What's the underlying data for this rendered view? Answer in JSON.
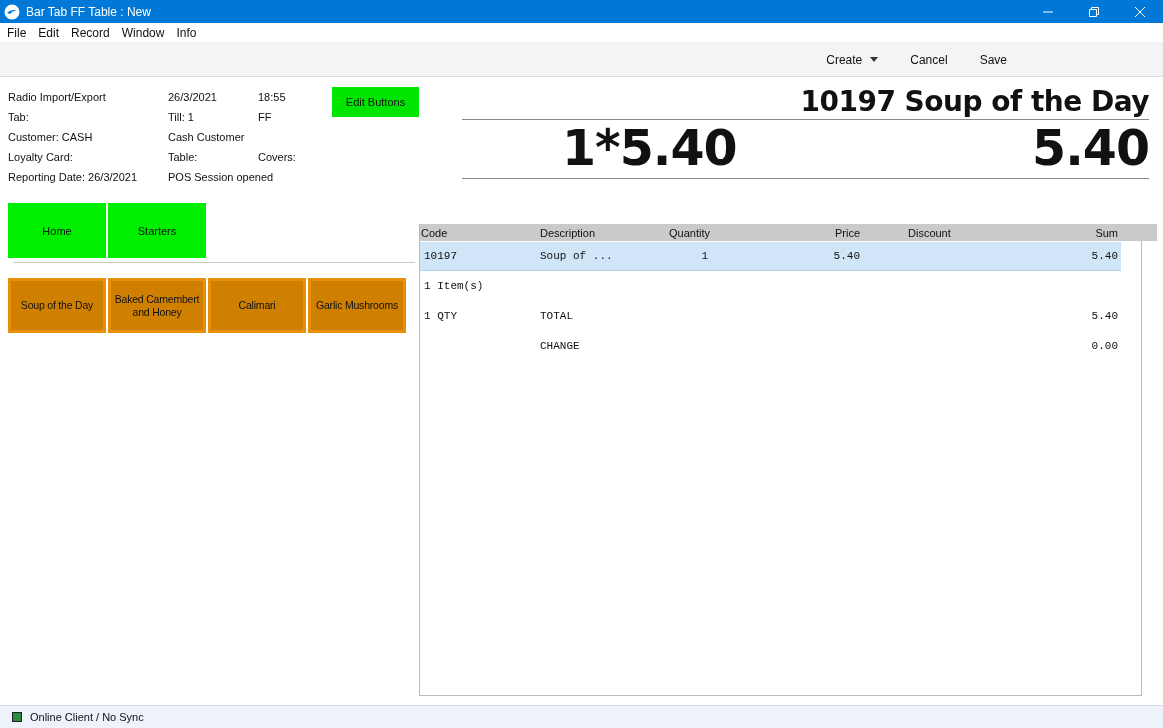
{
  "window": {
    "title": "Bar Tab FF Table : New"
  },
  "menu": [
    "File",
    "Edit",
    "Record",
    "Window",
    "Info"
  ],
  "toolbar": [
    {
      "label": "Create",
      "kind": "dropdown"
    },
    {
      "label": "Cancel",
      "kind": "plain"
    },
    {
      "label": "Save",
      "kind": "plain"
    }
  ],
  "info": [
    [
      "Radio Import/Export",
      "26/3/2021",
      "18:55"
    ],
    [
      "Tab:",
      "Till: 1",
      "FF"
    ],
    [
      "Customer: CASH",
      "Cash Customer"
    ],
    [
      "Loyalty Card:",
      "Table:",
      "Covers:"
    ],
    [
      "Reporting Date: 26/3/2021",
      "POS Session opened"
    ]
  ],
  "edit_button": "Edit Buttons",
  "display": {
    "item": "10197 Soup of the Day",
    "calculation": "1*5.40",
    "amount": "5.40"
  },
  "categories": [
    "Home",
    "Starters"
  ],
  "products": [
    "Soup of the Day",
    "Baked Camembert and Honey",
    "Calimari",
    "Garlic Mushrooms"
  ],
  "table": {
    "columns": [
      "Code",
      "Description",
      "Quantity",
      "Price",
      "Discount",
      "Sum"
    ],
    "rows": [
      {
        "selected": true,
        "code": "10197",
        "description": "Soup of ...",
        "quantity": "1",
        "price": "5.40",
        "sum": "5.40"
      },
      {
        "selected": false,
        "code": "1 Item(s)"
      },
      {
        "selected": false,
        "code": "1 QTY",
        "description": "TOTAL",
        "sum": "5.40"
      },
      {
        "selected": false,
        "description": "CHANGE",
        "sum": "0.00"
      }
    ]
  },
  "status_bar": "Online Client / No Sync"
}
